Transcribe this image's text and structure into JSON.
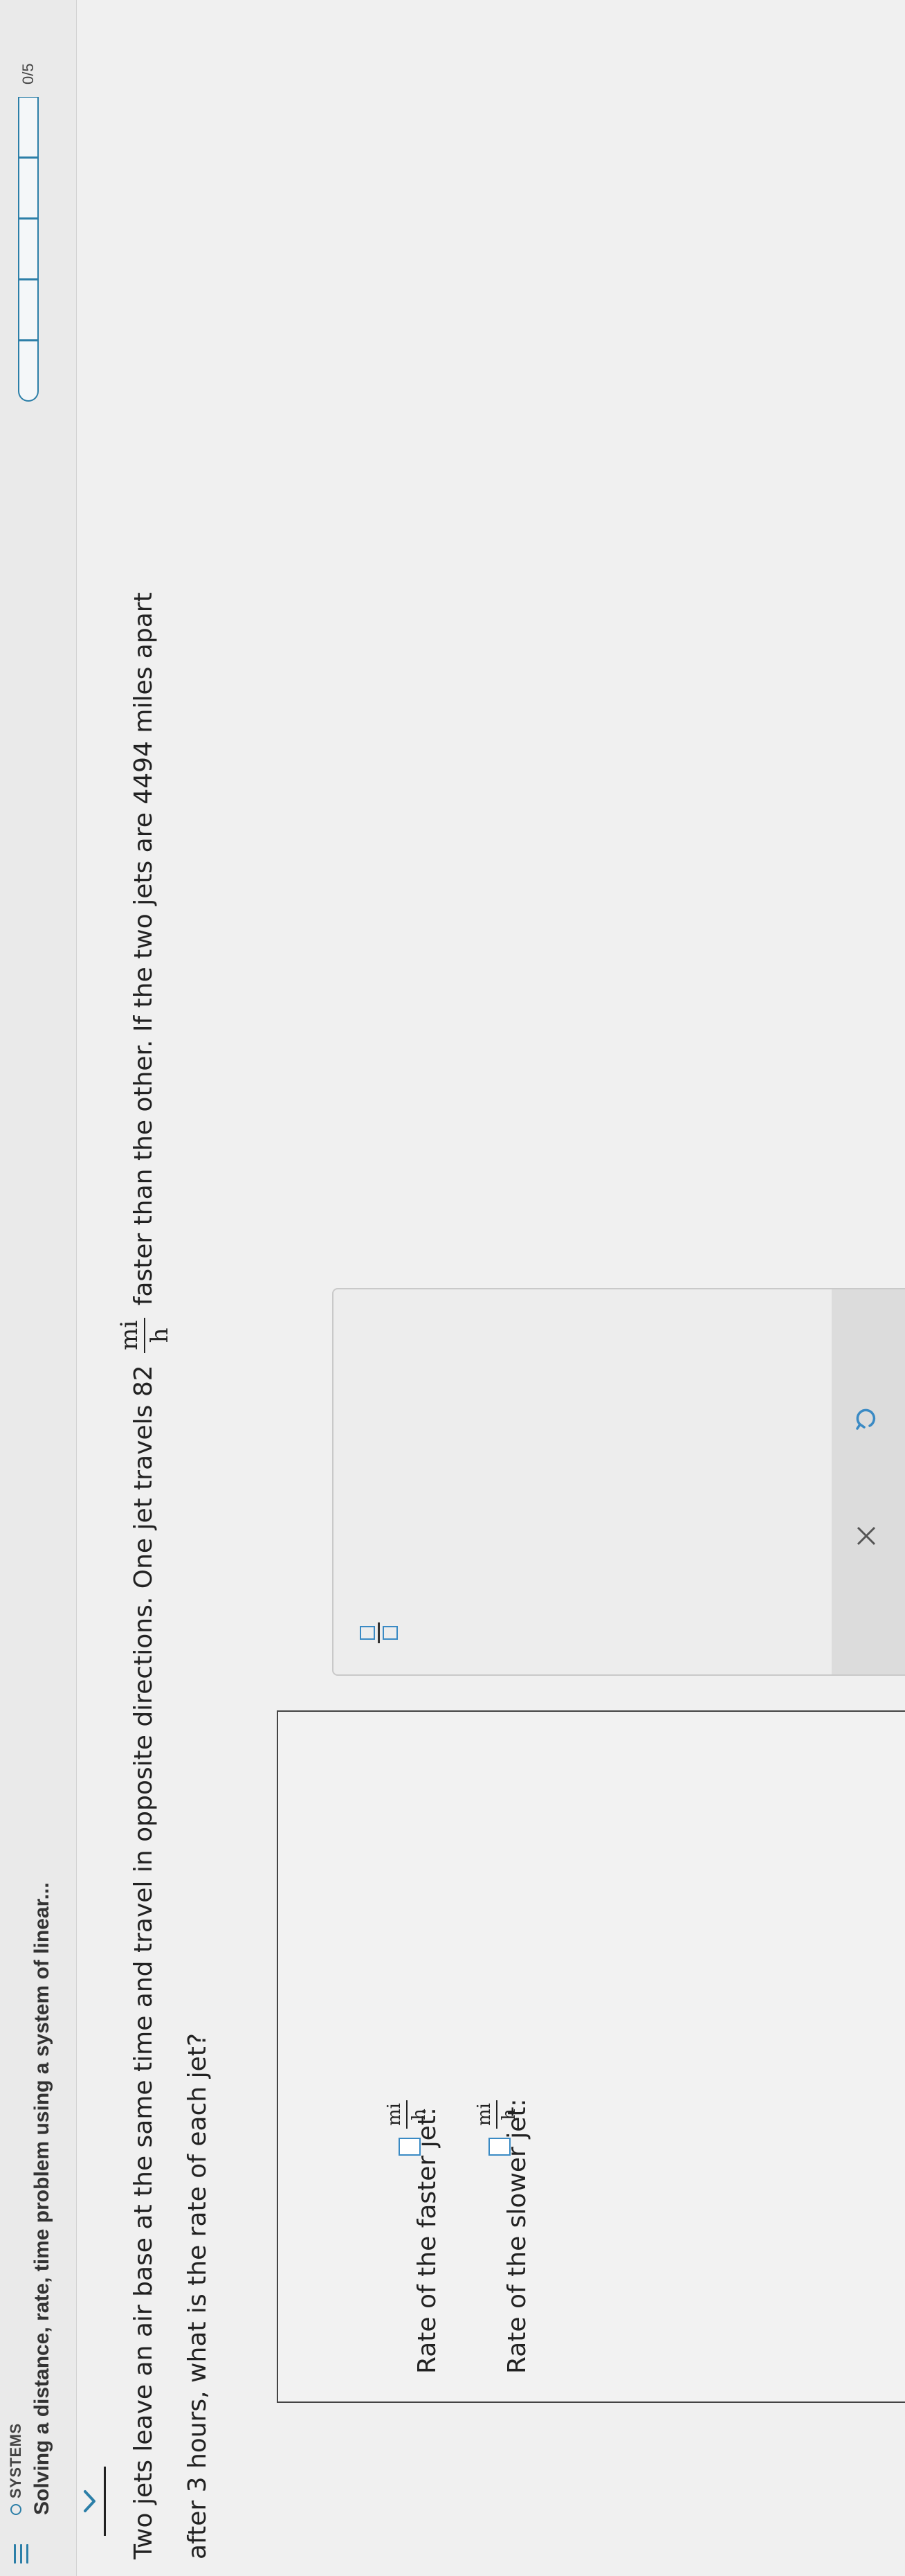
{
  "header": {
    "topic": "SYSTEMS",
    "title": "Solving a distance, rate, time problem using a system of linear...",
    "progress_count": "0/5"
  },
  "question": {
    "part1": "Two jets leave an air base at the same time and travel in opposite directions. One jet travels 82",
    "unit_num": "mi",
    "unit_den": "h",
    "part2": "faster than the other. If the two jets are 4494 miles apart",
    "part3": "after 3 hours, what is the rate of each jet?"
  },
  "answers": [
    {
      "label": "Rate of the faster jet:",
      "value": "",
      "unit_num": "mi",
      "unit_den": "h"
    },
    {
      "label": "Rate of the slower jet:",
      "value": "",
      "unit_num": "mi",
      "unit_den": "h"
    }
  ],
  "icons": {
    "menu": "menu-icon",
    "status": "status-circle-icon",
    "collapse": "chevron-down-icon",
    "fraction": "fraction-icon",
    "clear": "close-icon",
    "undo": "undo-icon"
  },
  "colors": {
    "accent": "#2c7fa8",
    "input_border": "#3a8ac4",
    "background": "#f0f0f0"
  }
}
